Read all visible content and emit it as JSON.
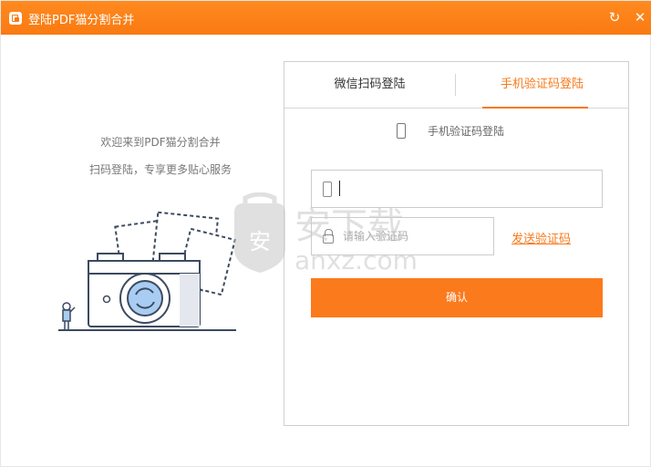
{
  "window": {
    "title": "登陆PDF猫分割合并",
    "refresh_symbol": "↻",
    "close_symbol": "✕"
  },
  "left": {
    "welcome": "欢迎来到PDF猫分割合并",
    "tagline": "扫码登陆，专享更多贴心服务"
  },
  "login": {
    "tabs": [
      {
        "label": "微信扫码登陆",
        "active": false
      },
      {
        "label": "手机验证码登陆",
        "active": true
      }
    ],
    "sub_heading": "手机验证码登陆",
    "phone_value": "",
    "code_placeholder": "请输入验证码",
    "send_code": "发送验证码",
    "confirm": "确认"
  },
  "watermark": {
    "badge_char": "安",
    "brand": "安下载",
    "domain": "anxz.com"
  },
  "colors": {
    "accent": "#f7791a",
    "titlebar": "#fa7d16",
    "border": "#cfcfcf",
    "illustration_blue": "#a9cdf2",
    "illustration_stroke": "#3d4a60"
  },
  "icons": [
    "app-logo-icon",
    "refresh-icon",
    "close-icon",
    "phone-icon",
    "lock-icon",
    "camera-illustration"
  ]
}
